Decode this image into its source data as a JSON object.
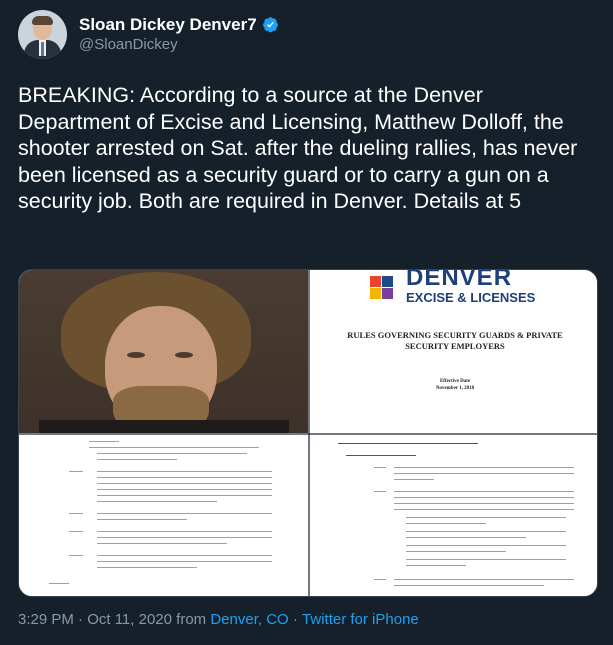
{
  "author": {
    "display_name": "Sloan Dickey Denver7",
    "handle": "@SloanDickey",
    "verified_icon": "verified-badge-icon"
  },
  "tweet": {
    "text": "BREAKING: According to a source at the Denver Department of Excise and Licensing, Matthew Dolloff, the shooter arrested on Sat. after the dueling rallies, has never been licensed as a security guard or to carry a gun on a security job. Both are required in Denver. Details at 5"
  },
  "media": {
    "cover": {
      "brand_line1": "DENVER",
      "brand_line2": "EXCISE & LICENSES",
      "title": "RULES GOVERNING SECURITY GUARDS & PRIVATE SECURITY EMPLOYERS",
      "effective_label": "Effective Date",
      "effective_date": "November 1, 2018"
    }
  },
  "meta": {
    "time_date": "3:29 PM · Oct 11, 2020",
    "from_word": " from ",
    "location": "Denver, CO",
    "separator": " · ",
    "source": "Twitter for iPhone"
  },
  "colors": {
    "background": "#15202b",
    "text_primary": "#ffffff",
    "text_secondary": "#8899a6",
    "link": "#1da1f2"
  }
}
